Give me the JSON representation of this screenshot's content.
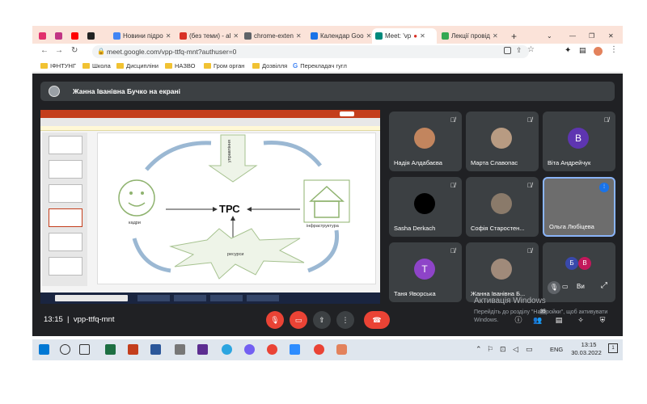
{
  "browser": {
    "tabs": [
      {
        "title": "Новини підро",
        "color": "#4285f4"
      },
      {
        "title": "(без теми) - al",
        "color": "#d93025"
      },
      {
        "title": "chrome-exten",
        "color": "#5f6368"
      },
      {
        "title": "Календар Goo",
        "color": "#1a73e8"
      },
      {
        "title": "Meet: 'vp",
        "color": "#00897b"
      },
      {
        "title": "Лекції провід",
        "color": "#34a853"
      }
    ],
    "url": "meet.google.com/vpp-ttfq-mnt?authuser=0",
    "bookmarks": [
      "ІФНТУНГ",
      "Школа",
      "Дисципліни",
      "НАЗВО",
      "Гром орган",
      "Дозвілля",
      "Перекладач гугл"
    ]
  },
  "meet": {
    "presenting_text": "Жанна Іванівна Бучко на екрані",
    "slide": {
      "center_label": "ТРС",
      "top_label": "управління",
      "left_label": "кадри",
      "right_label": "інфраструктура",
      "bottom_label": "ресурси"
    },
    "participants": [
      {
        "name": "Надія Алдабаєва",
        "avatar_color": "#c2855e",
        "avatar_letter": ""
      },
      {
        "name": "Марта Славопас",
        "avatar_color": "#b89b82",
        "avatar_letter": ""
      },
      {
        "name": "Віта Андрейчук",
        "avatar_color": "#5e35b1",
        "avatar_letter": "В"
      },
      {
        "name": "Sasha Derkach",
        "avatar_color": "#000000",
        "avatar_letter": ""
      },
      {
        "name": "Софія Старостен...",
        "avatar_color": "#8a7a6a",
        "avatar_letter": ""
      },
      {
        "name": "Ольга Любіцева",
        "avatar_color": "#777777",
        "avatar_letter": ""
      },
      {
        "name": "Таня Яворська",
        "avatar_color": "#8e44c8",
        "avatar_letter": "Т"
      },
      {
        "name": "Жанна Іванівна Б...",
        "avatar_color": "#a08a7a",
        "avatar_letter": ""
      },
      {
        "name": "Ви",
        "avatar_color": "#3949ab",
        "avatar_letter": "Б"
      }
    ],
    "extra_avatar_letter": "В",
    "time": "13:15",
    "meeting_code": "vpp-ttfq-mnt",
    "participants_count": "35",
    "win_activation_title": "Активація Windows",
    "win_activation_text": "Перейдіть до розділу \"Настройки\", щоб активувати Windows."
  },
  "taskbar": {
    "lang": "ENG",
    "time": "13:15",
    "date": "30.03.2022",
    "notifications": "1"
  },
  "colors": {
    "meet_bg": "#202124",
    "tile_bg": "#3c4043",
    "end_call": "#ea4335",
    "accent_border": "#8ab4f8"
  }
}
